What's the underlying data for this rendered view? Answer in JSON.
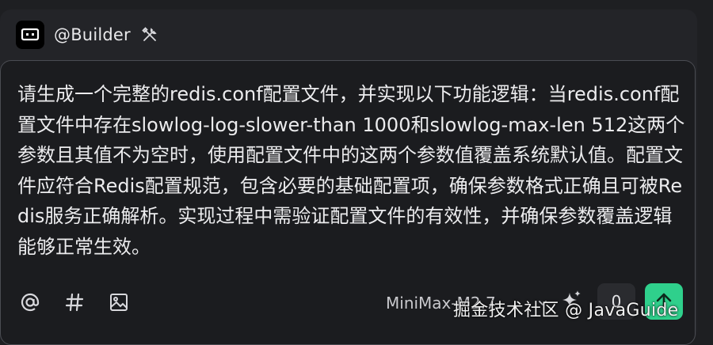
{
  "agent": {
    "name": "@Builder",
    "avatar_icon": "chat-bubble-icon",
    "tools_icon": "tools-icon"
  },
  "composer": {
    "prompt_lines": [
      "请生成一个完整的redis.conf配置文件，并实现以下功能逻辑：当",
      "redis.conf配置文件中存在slowlog-log-slower-than 1000和slowlog-",
      "max-len 512这两个参数且其值不为空时，使用配置文件中的这两个参",
      "数值覆盖系统默认值。配置文件应符合Redis配置规范，包含必要的基",
      "础配置项，确保参数格式正确且可被Redis服务正确解析。实现过程中",
      "需验证配置文件的有效性，并确保参数覆盖逻辑能够正常生效。"
    ]
  },
  "toolbar": {
    "mention_icon": "at-icon",
    "hashtag_icon": "hashtag-icon",
    "image_icon": "image-icon",
    "model_label": "MiniMax-M2.7",
    "sparkle_icon": "sparkle-icon",
    "counter": "0",
    "send_icon": "arrow-up-icon"
  },
  "watermark": "掘金技术社区 @ JavaGuide",
  "colors": {
    "accent": "#2fd08c",
    "background": "#1b1c1f"
  }
}
